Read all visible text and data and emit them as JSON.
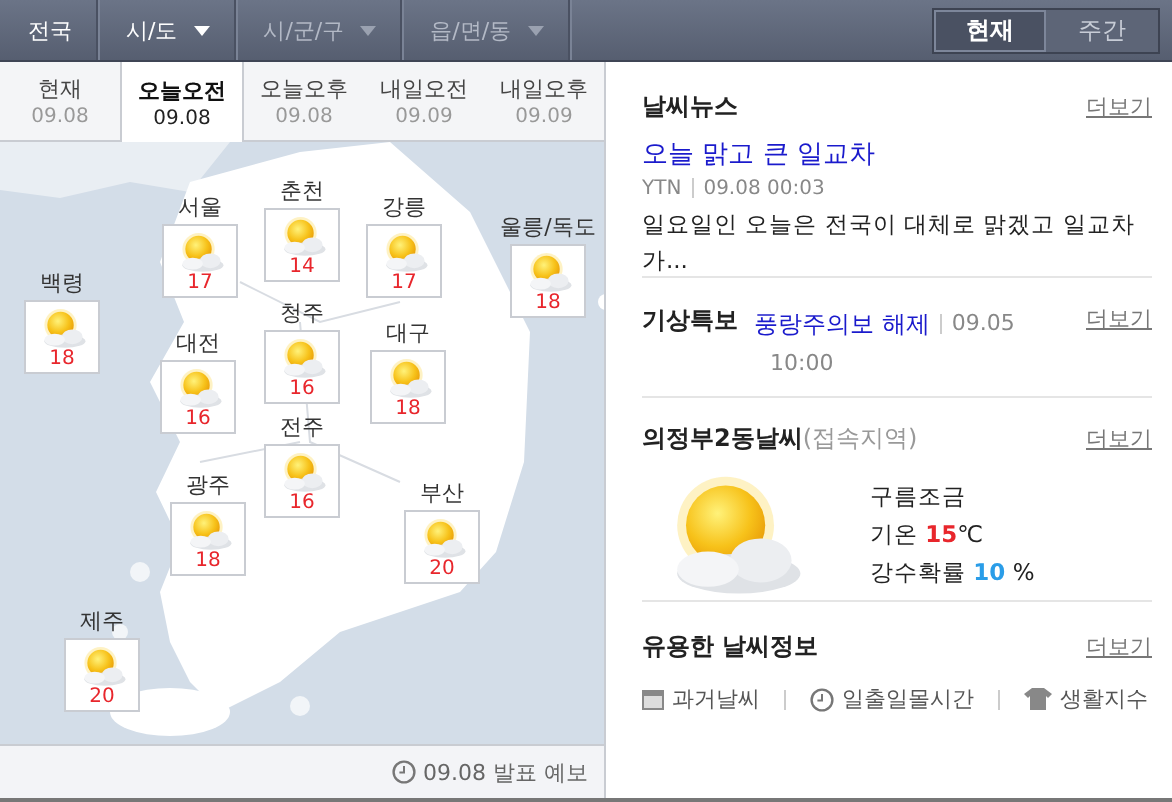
{
  "location_bar": {
    "crumbs": [
      {
        "label": "전국",
        "kind": "plain",
        "disabled": false
      },
      {
        "label": "시/도",
        "kind": "dropdown",
        "disabled": false
      },
      {
        "label": "시/군/구",
        "kind": "dropdown",
        "disabled": true
      },
      {
        "label": "읍/면/동",
        "kind": "dropdown",
        "disabled": true
      }
    ],
    "view_toggle": [
      {
        "label": "현재",
        "selected": true
      },
      {
        "label": "주간",
        "selected": false
      }
    ]
  },
  "time_tabs": [
    {
      "label": "현재",
      "date": "09.08",
      "selected": false
    },
    {
      "label": "오늘오전",
      "date": "09.08",
      "selected": true
    },
    {
      "label": "오늘오후",
      "date": "09.08",
      "selected": false
    },
    {
      "label": "내일오전",
      "date": "09.09",
      "selected": false
    },
    {
      "label": "내일오후",
      "date": "09.09",
      "selected": false
    }
  ],
  "map": {
    "cities": [
      {
        "name": "서울",
        "temp": "17"
      },
      {
        "name": "춘천",
        "temp": "14"
      },
      {
        "name": "강릉",
        "temp": "17"
      },
      {
        "name": "울릉/독도",
        "temp": "18"
      },
      {
        "name": "백령",
        "temp": "18"
      },
      {
        "name": "대전",
        "temp": "16"
      },
      {
        "name": "청주",
        "temp": "16"
      },
      {
        "name": "대구",
        "temp": "18"
      },
      {
        "name": "전주",
        "temp": "16"
      },
      {
        "name": "광주",
        "temp": "18"
      },
      {
        "name": "부산",
        "temp": "20"
      },
      {
        "name": "제주",
        "temp": "20"
      }
    ]
  },
  "forecast_note": "09.08 발표 예보",
  "news": {
    "title": "날씨뉴스",
    "more": "더보기",
    "headline": "오늘 맑고 큰 일교차",
    "source": "YTN",
    "time": "09.08 00:03",
    "summary": "일요일인 오늘은 전국이 대체로 맑겠고 일교차가..."
  },
  "warning": {
    "title": "기상특보",
    "more": "더보기",
    "headline": "풍랑주의보 해제",
    "date": "09.05",
    "time": "10:00"
  },
  "local": {
    "title": "의정부2동날씨",
    "note": "(접속지역)",
    "more": "더보기",
    "condition": "구름조금",
    "temp_label": "기온",
    "temp": "15",
    "temp_unit": "℃",
    "rain_label": "강수확률",
    "rain": "10",
    "rain_unit": "%"
  },
  "useful": {
    "title": "유용한 날씨정보",
    "more": "더보기",
    "links": [
      {
        "label": "과거날씨",
        "kind": "calendar"
      },
      {
        "label": "일출일몰시간",
        "kind": "clock"
      },
      {
        "label": "생활지수",
        "kind": "shirt"
      }
    ]
  }
}
